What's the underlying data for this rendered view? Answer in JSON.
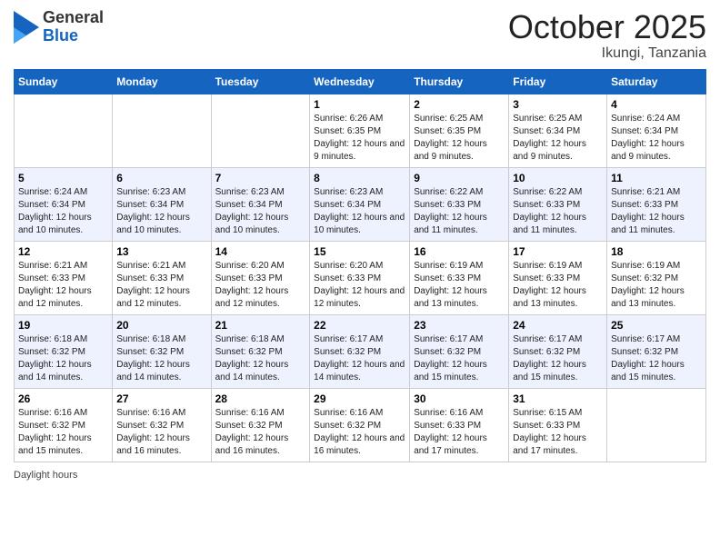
{
  "header": {
    "logo_general": "General",
    "logo_blue": "Blue",
    "month": "October 2025",
    "location": "Ikungi, Tanzania"
  },
  "days_of_week": [
    "Sunday",
    "Monday",
    "Tuesday",
    "Wednesday",
    "Thursday",
    "Friday",
    "Saturday"
  ],
  "weeks": [
    [
      {
        "day": "",
        "sunrise": "",
        "sunset": "",
        "daylight": ""
      },
      {
        "day": "",
        "sunrise": "",
        "sunset": "",
        "daylight": ""
      },
      {
        "day": "",
        "sunrise": "",
        "sunset": "",
        "daylight": ""
      },
      {
        "day": "1",
        "sunrise": "Sunrise: 6:26 AM",
        "sunset": "Sunset: 6:35 PM",
        "daylight": "Daylight: 12 hours and 9 minutes."
      },
      {
        "day": "2",
        "sunrise": "Sunrise: 6:25 AM",
        "sunset": "Sunset: 6:35 PM",
        "daylight": "Daylight: 12 hours and 9 minutes."
      },
      {
        "day": "3",
        "sunrise": "Sunrise: 6:25 AM",
        "sunset": "Sunset: 6:34 PM",
        "daylight": "Daylight: 12 hours and 9 minutes."
      },
      {
        "day": "4",
        "sunrise": "Sunrise: 6:24 AM",
        "sunset": "Sunset: 6:34 PM",
        "daylight": "Daylight: 12 hours and 9 minutes."
      }
    ],
    [
      {
        "day": "5",
        "sunrise": "Sunrise: 6:24 AM",
        "sunset": "Sunset: 6:34 PM",
        "daylight": "Daylight: 12 hours and 10 minutes."
      },
      {
        "day": "6",
        "sunrise": "Sunrise: 6:23 AM",
        "sunset": "Sunset: 6:34 PM",
        "daylight": "Daylight: 12 hours and 10 minutes."
      },
      {
        "day": "7",
        "sunrise": "Sunrise: 6:23 AM",
        "sunset": "Sunset: 6:34 PM",
        "daylight": "Daylight: 12 hours and 10 minutes."
      },
      {
        "day": "8",
        "sunrise": "Sunrise: 6:23 AM",
        "sunset": "Sunset: 6:34 PM",
        "daylight": "Daylight: 12 hours and 10 minutes."
      },
      {
        "day": "9",
        "sunrise": "Sunrise: 6:22 AM",
        "sunset": "Sunset: 6:33 PM",
        "daylight": "Daylight: 12 hours and 11 minutes."
      },
      {
        "day": "10",
        "sunrise": "Sunrise: 6:22 AM",
        "sunset": "Sunset: 6:33 PM",
        "daylight": "Daylight: 12 hours and 11 minutes."
      },
      {
        "day": "11",
        "sunrise": "Sunrise: 6:21 AM",
        "sunset": "Sunset: 6:33 PM",
        "daylight": "Daylight: 12 hours and 11 minutes."
      }
    ],
    [
      {
        "day": "12",
        "sunrise": "Sunrise: 6:21 AM",
        "sunset": "Sunset: 6:33 PM",
        "daylight": "Daylight: 12 hours and 12 minutes."
      },
      {
        "day": "13",
        "sunrise": "Sunrise: 6:21 AM",
        "sunset": "Sunset: 6:33 PM",
        "daylight": "Daylight: 12 hours and 12 minutes."
      },
      {
        "day": "14",
        "sunrise": "Sunrise: 6:20 AM",
        "sunset": "Sunset: 6:33 PM",
        "daylight": "Daylight: 12 hours and 12 minutes."
      },
      {
        "day": "15",
        "sunrise": "Sunrise: 6:20 AM",
        "sunset": "Sunset: 6:33 PM",
        "daylight": "Daylight: 12 hours and 12 minutes."
      },
      {
        "day": "16",
        "sunrise": "Sunrise: 6:19 AM",
        "sunset": "Sunset: 6:33 PM",
        "daylight": "Daylight: 12 hours and 13 minutes."
      },
      {
        "day": "17",
        "sunrise": "Sunrise: 6:19 AM",
        "sunset": "Sunset: 6:33 PM",
        "daylight": "Daylight: 12 hours and 13 minutes."
      },
      {
        "day": "18",
        "sunrise": "Sunrise: 6:19 AM",
        "sunset": "Sunset: 6:32 PM",
        "daylight": "Daylight: 12 hours and 13 minutes."
      }
    ],
    [
      {
        "day": "19",
        "sunrise": "Sunrise: 6:18 AM",
        "sunset": "Sunset: 6:32 PM",
        "daylight": "Daylight: 12 hours and 14 minutes."
      },
      {
        "day": "20",
        "sunrise": "Sunrise: 6:18 AM",
        "sunset": "Sunset: 6:32 PM",
        "daylight": "Daylight: 12 hours and 14 minutes."
      },
      {
        "day": "21",
        "sunrise": "Sunrise: 6:18 AM",
        "sunset": "Sunset: 6:32 PM",
        "daylight": "Daylight: 12 hours and 14 minutes."
      },
      {
        "day": "22",
        "sunrise": "Sunrise: 6:17 AM",
        "sunset": "Sunset: 6:32 PM",
        "daylight": "Daylight: 12 hours and 14 minutes."
      },
      {
        "day": "23",
        "sunrise": "Sunrise: 6:17 AM",
        "sunset": "Sunset: 6:32 PM",
        "daylight": "Daylight: 12 hours and 15 minutes."
      },
      {
        "day": "24",
        "sunrise": "Sunrise: 6:17 AM",
        "sunset": "Sunset: 6:32 PM",
        "daylight": "Daylight: 12 hours and 15 minutes."
      },
      {
        "day": "25",
        "sunrise": "Sunrise: 6:17 AM",
        "sunset": "Sunset: 6:32 PM",
        "daylight": "Daylight: 12 hours and 15 minutes."
      }
    ],
    [
      {
        "day": "26",
        "sunrise": "Sunrise: 6:16 AM",
        "sunset": "Sunset: 6:32 PM",
        "daylight": "Daylight: 12 hours and 15 minutes."
      },
      {
        "day": "27",
        "sunrise": "Sunrise: 6:16 AM",
        "sunset": "Sunset: 6:32 PM",
        "daylight": "Daylight: 12 hours and 16 minutes."
      },
      {
        "day": "28",
        "sunrise": "Sunrise: 6:16 AM",
        "sunset": "Sunset: 6:32 PM",
        "daylight": "Daylight: 12 hours and 16 minutes."
      },
      {
        "day": "29",
        "sunrise": "Sunrise: 6:16 AM",
        "sunset": "Sunset: 6:32 PM",
        "daylight": "Daylight: 12 hours and 16 minutes."
      },
      {
        "day": "30",
        "sunrise": "Sunrise: 6:16 AM",
        "sunset": "Sunset: 6:33 PM",
        "daylight": "Daylight: 12 hours and 17 minutes."
      },
      {
        "day": "31",
        "sunrise": "Sunrise: 6:15 AM",
        "sunset": "Sunset: 6:33 PM",
        "daylight": "Daylight: 12 hours and 17 minutes."
      },
      {
        "day": "",
        "sunrise": "",
        "sunset": "",
        "daylight": ""
      }
    ]
  ],
  "footer": {
    "daylight_label": "Daylight hours"
  }
}
